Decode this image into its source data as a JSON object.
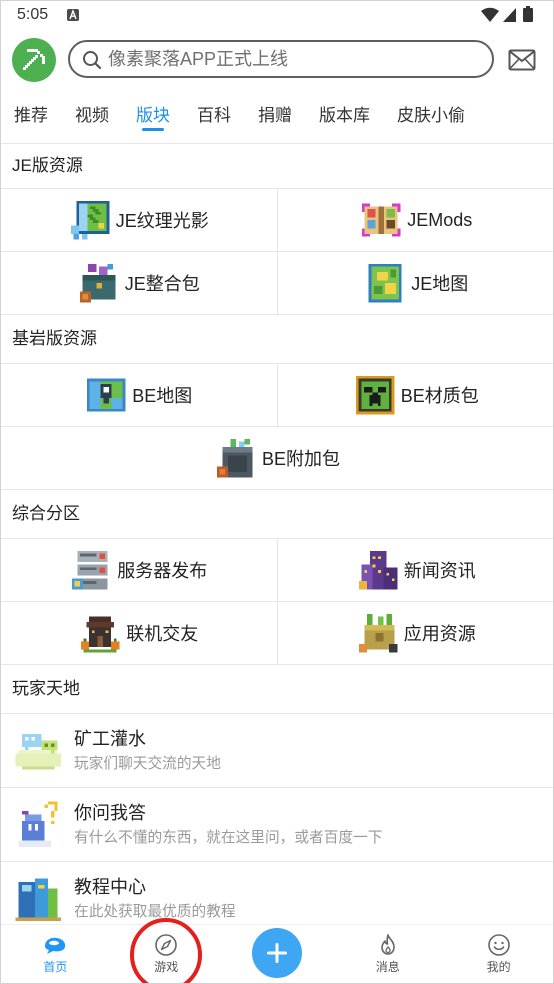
{
  "status_bar": {
    "time": "5:05",
    "icons": [
      "a-notification-icon",
      "wifi-icon",
      "signal-icon",
      "battery-icon"
    ]
  },
  "header": {
    "logo_icon": "pickaxe-logo-icon",
    "search_icon": "search-icon",
    "search_placeholder": "像素聚落APP正式上线",
    "mail_icon": "mail-icon"
  },
  "tabs": [
    {
      "label": "推荐",
      "active": false
    },
    {
      "label": "视频",
      "active": false
    },
    {
      "label": "版块",
      "active": true
    },
    {
      "label": "百科",
      "active": false
    },
    {
      "label": "捐赠",
      "active": false
    },
    {
      "label": "版本库",
      "active": false
    },
    {
      "label": "皮肤小偷",
      "active": false
    }
  ],
  "sections": [
    {
      "title": "JE版资源",
      "items": [
        {
          "label": "JE纹理光影",
          "icon": "texture-shader-icon"
        },
        {
          "label": "JEMods",
          "icon": "mods-book-icon"
        },
        {
          "label": "JE整合包",
          "icon": "modpack-chest-icon"
        },
        {
          "label": "JE地图",
          "icon": "je-map-icon"
        }
      ]
    },
    {
      "title": "基岩版资源",
      "items": [
        {
          "label": "BE地图",
          "icon": "be-map-icon"
        },
        {
          "label": "BE材质包",
          "icon": "creeper-block-icon"
        },
        {
          "label": "BE附加包",
          "icon": "addon-box-icon"
        }
      ]
    },
    {
      "title": "综合分区",
      "items": [
        {
          "label": "服务器发布",
          "icon": "server-icon"
        },
        {
          "label": "新闻资讯",
          "icon": "news-building-icon"
        },
        {
          "label": "联机交友",
          "icon": "multiplayer-house-icon"
        },
        {
          "label": "应用资源",
          "icon": "app-resource-icon"
        }
      ]
    }
  ],
  "player_section": {
    "title": "玩家天地",
    "items": [
      {
        "title": "矿工灌水",
        "subtitle": "玩家们聊天交流的天地",
        "icon": "chat-island-icon"
      },
      {
        "title": "你问我答",
        "subtitle": "有什么不懂的东西，就在这里问，或者百度一下",
        "icon": "question-icon"
      },
      {
        "title": "教程中心",
        "subtitle": "在此处获取最优质的教程",
        "icon": "tutorial-book-icon"
      }
    ]
  },
  "bottom_nav": [
    {
      "label": "首页",
      "icon": "home-bubble-icon",
      "active": true
    },
    {
      "label": "游戏",
      "icon": "compass-icon",
      "active": false
    },
    {
      "icon": "plus-icon",
      "active": false
    },
    {
      "label": "消息",
      "icon": "flame-icon",
      "active": false
    },
    {
      "label": "我的",
      "icon": "smiley-icon",
      "active": false
    }
  ],
  "colors": {
    "accent": "#1e8fe8",
    "plus_button": "#3ea6f2",
    "logo_green": "#4caf50",
    "text": "#222222",
    "subtitle": "#9a9a9a",
    "divider": "#e6e6e6",
    "highlight_ring": "#e3201b"
  }
}
